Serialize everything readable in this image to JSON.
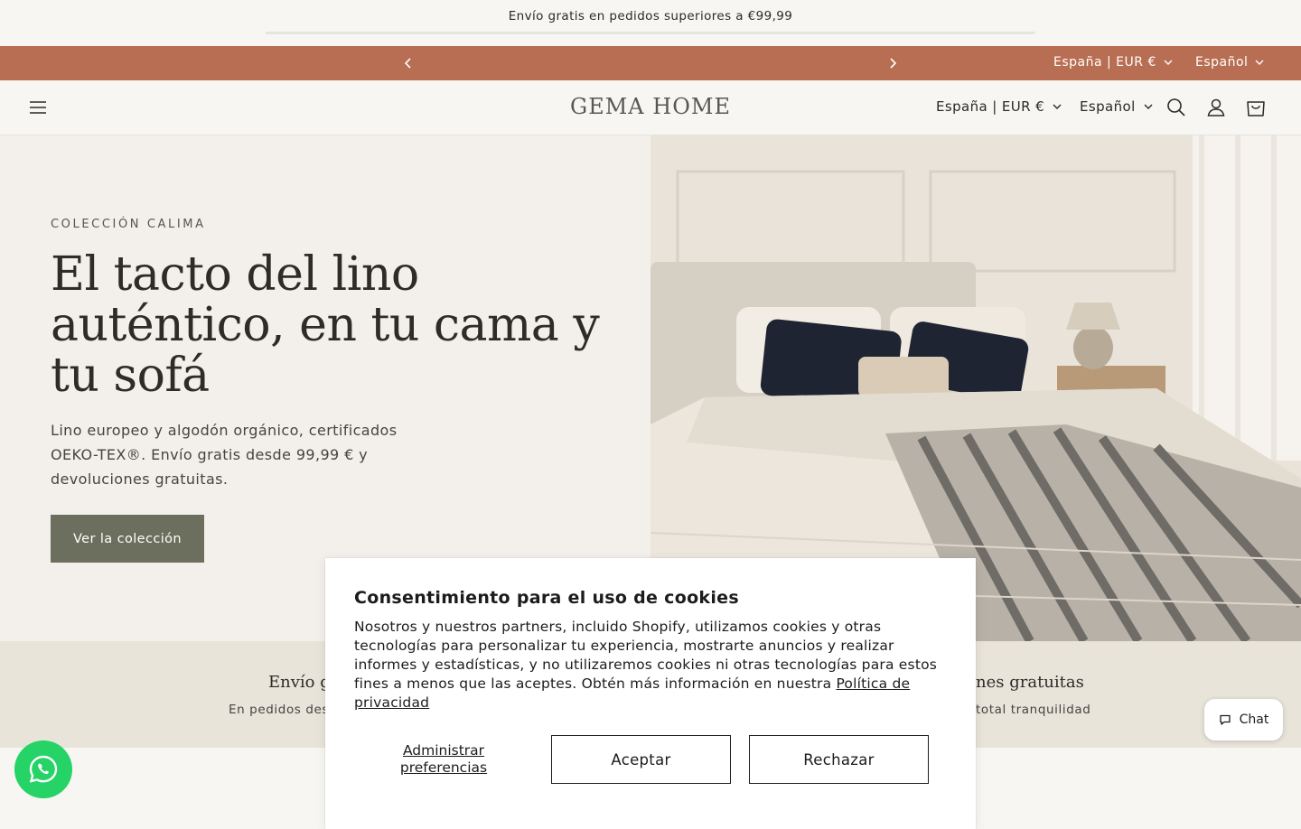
{
  "announcement": {
    "text": "Envío gratis en pedidos superiores a €99,99"
  },
  "utility_bar": {
    "country_label": "España | EUR €",
    "language_label": "Español"
  },
  "header": {
    "logo": "GEMA HOME",
    "country_label": "España | EUR €",
    "language_label": "Español"
  },
  "hero": {
    "eyebrow": "COLECCIÓN CALIMA",
    "title": "El tacto del lino auténtico, en tu cama y tu sofá",
    "subtitle": "Lino europeo y algodón orgánico, certificados OEKO-TEX®. Envío gratis desde 99,99 € y devoluciones gratuitas.",
    "button": "Ver la colección"
  },
  "features": {
    "left_title": "Envío gr",
    "left_sub": "En pedidos des",
    "right_title": "nes gratuitas",
    "right_sub": "total tranquilidad"
  },
  "cookie": {
    "title": "Consentimiento para el uso de cookies",
    "body": "Nosotros y nuestros partners, incluido Shopify, utilizamos cookies y otras tecnologías para personalizar tu experiencia, mostrarte anuncios y realizar informes y estadísticas, y no utilizaremos cookies ni otras tecnologías para estos fines a menos que las aceptes. Obtén más información en nuestra",
    "link": "Política de privacidad",
    "manage": "Administrar preferencias",
    "accept": "Aceptar",
    "reject": "Rechazar"
  },
  "chat": {
    "label": "Chat"
  },
  "colors": {
    "accent_bar": "#b86e52",
    "hero_button": "#6c6f5d",
    "whatsapp": "#25d366"
  }
}
